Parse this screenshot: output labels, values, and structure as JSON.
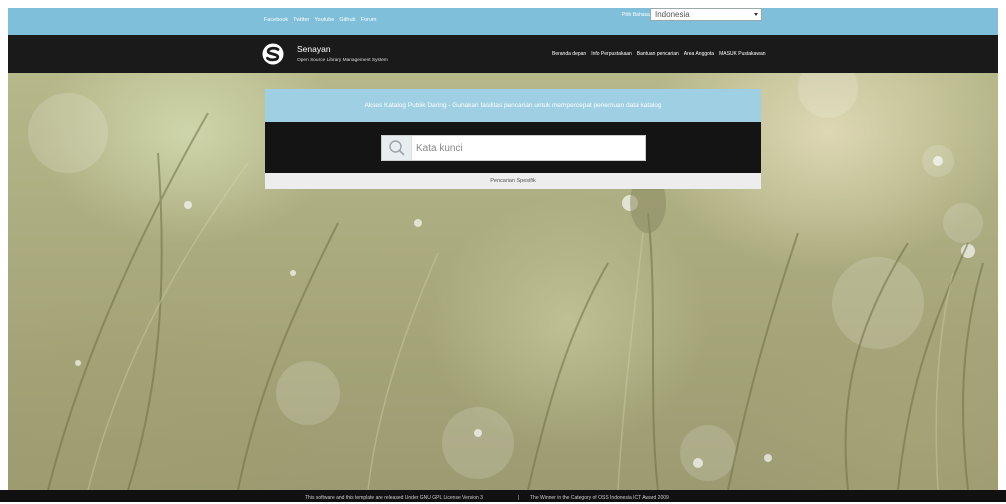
{
  "topbar": {
    "links": [
      "Facebook",
      "Twitter",
      "Youtube",
      "Github",
      "Forum"
    ],
    "language_label": "Pilih Bahasa",
    "language_selected": "Indonesia"
  },
  "header": {
    "brand": "Senayan",
    "tagline": "Open Source Library Management System",
    "nav": [
      "Beranda depan",
      "Info Perpustakaan",
      "Bantuan pencarian",
      "Area Anggota",
      "MASUK Pustakawan"
    ]
  },
  "search": {
    "heading": "Akses Katalog Publik Daring - Gunakan fasilitas pencarian untuk mempercepat penemuan data katalog",
    "placeholder": "Kata kunci",
    "advanced_link": "Pencarian Spesifik"
  },
  "footer": {
    "license": "This software and this template are released Under GNU GPL License Version 3",
    "separator": "|",
    "award": "The Winner in the Category of OSS Indonesia ICT Award 2009"
  },
  "colors": {
    "topbar": "#7fbfd9",
    "header": "#1a1a1a",
    "panel_heading": "#9fcfe3",
    "panel_body": "#141414"
  },
  "icons": {
    "logo": "senayan-logo-icon",
    "search": "search-icon",
    "dropdown": "chevron-down-icon"
  }
}
